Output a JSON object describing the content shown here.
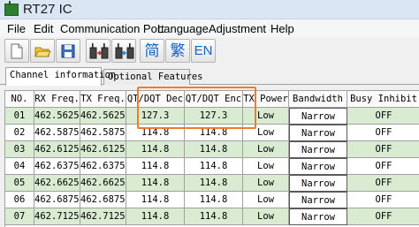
{
  "window": {
    "title": "RT27 IC"
  },
  "menu": [
    "File",
    "Edit",
    "Communication Port",
    "Language",
    "Adjustment",
    "Help"
  ],
  "toolbar": {
    "simplified_label": "简",
    "traditional_label": "繁",
    "english_label": "EN"
  },
  "tabs": [
    "Channel information",
    "Optional Features"
  ],
  "table": {
    "columns": [
      "NO.",
      "RX Freq.",
      "TX Freq.",
      "QT/DQT Dec",
      "QT/DQT Enc",
      "TX Power",
      "Bandwidth",
      "Busy Inhibit"
    ],
    "rows": [
      [
        "01",
        "462.56250",
        "462.56250",
        "127.3",
        "127.3",
        "Low",
        "Narrow",
        "OFF"
      ],
      [
        "02",
        "462.58750",
        "462.58750",
        "114.8",
        "114.8",
        "Low",
        "Narrow",
        "OFF"
      ],
      [
        "03",
        "462.61250",
        "462.61250",
        "114.8",
        "114.8",
        "Low",
        "Narrow",
        "OFF"
      ],
      [
        "04",
        "462.63750",
        "462.63750",
        "114.8",
        "114.8",
        "Low",
        "Narrow",
        "OFF"
      ],
      [
        "05",
        "462.66250",
        "462.66250",
        "114.8",
        "114.8",
        "Low",
        "Narrow",
        "OFF"
      ],
      [
        "06",
        "462.68750",
        "462.68750",
        "114.8",
        "114.8",
        "Low",
        "Narrow",
        "OFF"
      ],
      [
        "07",
        "462.71250",
        "462.71250",
        "114.8",
        "114.8",
        "Low",
        "Narrow",
        "OFF"
      ]
    ]
  },
  "colors": {
    "row_alt": "#d9ecd2",
    "annotation": "#ef7b2c"
  }
}
